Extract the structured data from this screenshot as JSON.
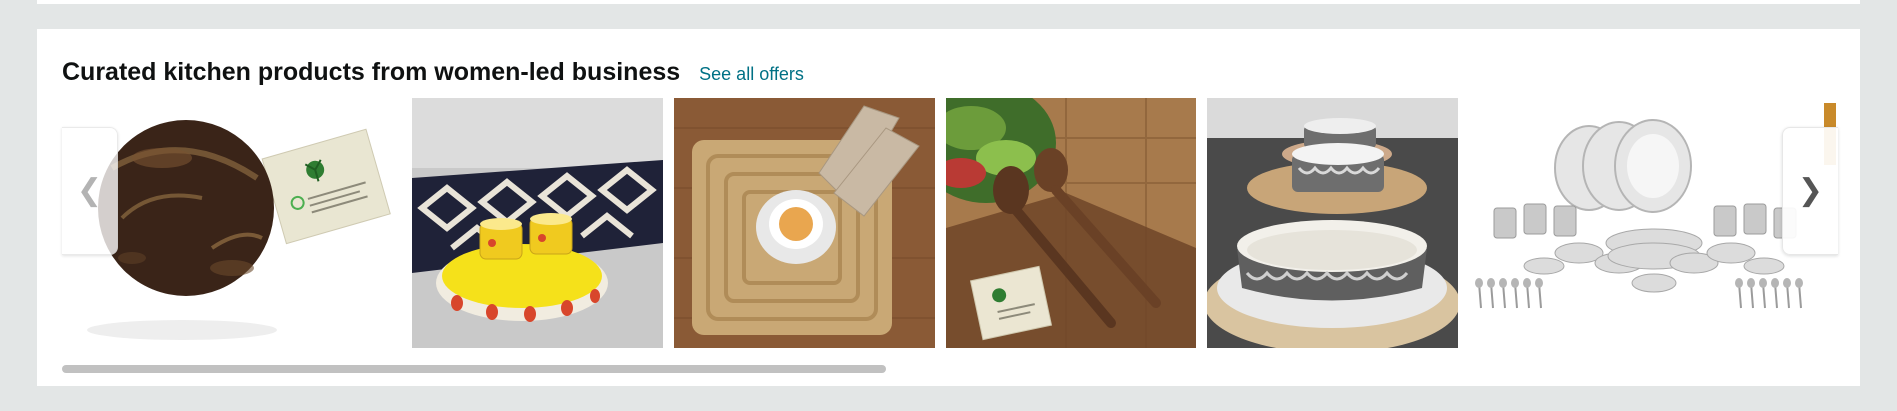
{
  "section": {
    "title": "Curated kitchen products from women-led business",
    "see_all_label": "See all offers"
  },
  "products": [
    {
      "subject": "coconut-shell-bowl"
    },
    {
      "subject": "ceramic-tray-with-cups"
    },
    {
      "subject": "jute-placemat-with-tea-cup"
    },
    {
      "subject": "wooden-salad-servers"
    },
    {
      "subject": "ceramic-bowls-on-jute-mats"
    },
    {
      "subject": "stainless-steel-dinner-set"
    }
  ],
  "navigation": {
    "prev_icon": "chevron-left-icon",
    "next_icon": "chevron-right-icon"
  },
  "colors": {
    "page_background": "#e3e6e6",
    "card_background": "#ffffff",
    "title_text": "#0f1111",
    "link": "#007185",
    "scrollbar_thumb": "#c1c1c1"
  }
}
